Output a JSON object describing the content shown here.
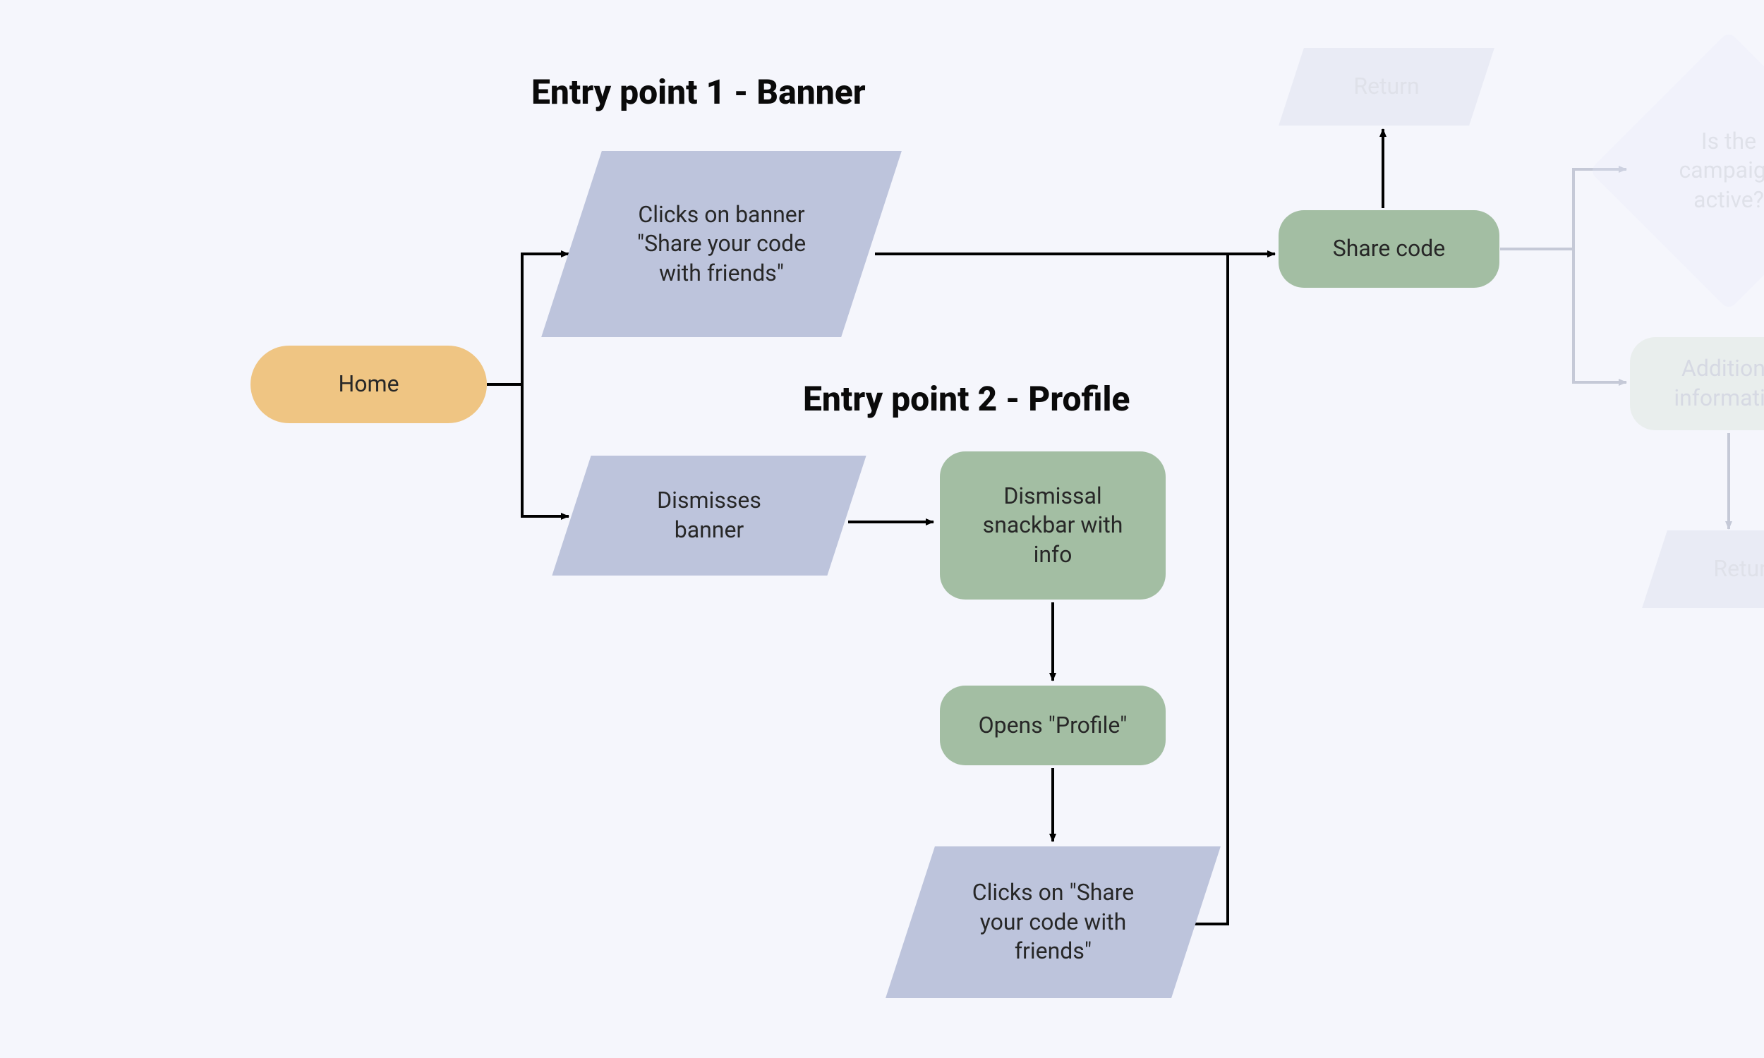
{
  "headings": {
    "entry1": "Entry point 1 - Banner",
    "entry2": "Entry point 2 - Profile"
  },
  "nodes": {
    "home": "Home",
    "click_banner": "Clicks on banner \"Share your code with friends\"",
    "dismiss_banner": "Dismisses banner",
    "dismissal_snackbar": "Dismissal snackbar with info",
    "opens_profile": "Opens \"Profile\"",
    "click_share_profile": "Clicks on \"Share your code with friends\"",
    "share_code": "Share code",
    "return_top": "Return",
    "campaign_active": "Is the campaign active?",
    "additional_info": "Additional information",
    "return_right": "Return"
  },
  "colors": {
    "canvas_bg": "#F5F6FC",
    "terminator_home": "#EFC583",
    "process_green": "#A3BEA3",
    "io_blue": "#BDC4DC",
    "heading_text": "#0a0a0a",
    "node_text": "#272727",
    "faded_text": "#9fa4b5"
  }
}
